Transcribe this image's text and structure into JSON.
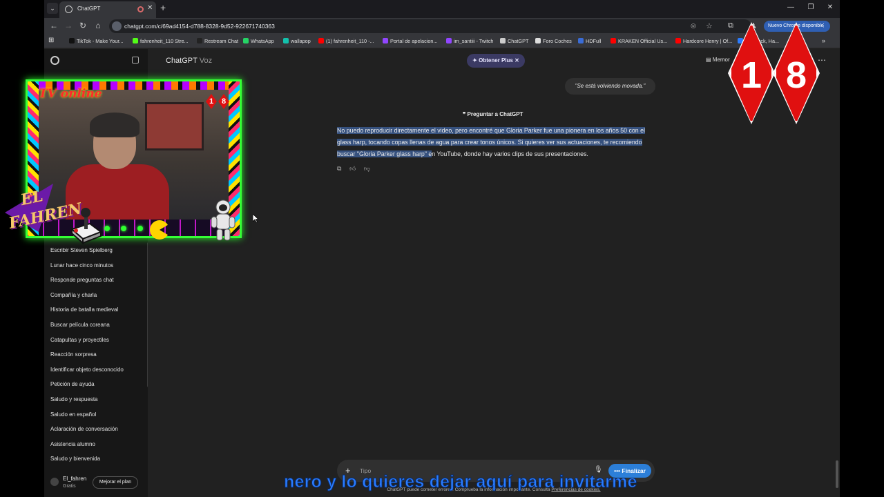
{
  "browser": {
    "tab_title": "ChatGPT",
    "url": "chatgpt.com/c/69ad4154-d788-8328-9d52-922671740363",
    "update_button": "Nuevo Chrome disponible",
    "bookmarks": [
      {
        "label": "TikTok - Make Your...",
        "color": "#111111"
      },
      {
        "label": "fahrenheit_110 Stre...",
        "color": "#53fc18"
      },
      {
        "label": "Restream Chat",
        "color": "#222222"
      },
      {
        "label": "WhatsApp",
        "color": "#25d366"
      },
      {
        "label": "wallapop",
        "color": "#13c1ac"
      },
      {
        "label": "(1) fahrenheit_110 -...",
        "color": "#ff0000"
      },
      {
        "label": "Portal de apelacion...",
        "color": "#9146ff"
      },
      {
        "label": "im_santiii - Twitch",
        "color": "#9146ff"
      },
      {
        "label": "ChatGPT",
        "color": "#cccccc"
      },
      {
        "label": "Foro Coches",
        "color": "#dddddd"
      },
      {
        "label": "HDFull",
        "color": "#3a6cd6"
      },
      {
        "label": "KRAKEN Official Us...",
        "color": "#ff0000"
      },
      {
        "label": "Hardcore Henry | Of...",
        "color": "#ff0000"
      },
      {
        "label": "ood Luck, Ha...",
        "color": "#2a7cff"
      }
    ]
  },
  "sidebar": {
    "items": [
      {
        "label": "Escribir Steven Spielberg"
      },
      {
        "label": "Lunar hace cinco minutos"
      },
      {
        "label": "Responde preguntas chat"
      },
      {
        "label": "Compañía y charla"
      },
      {
        "label": "Historia de batalla medieval"
      },
      {
        "label": "Buscar película coreana"
      },
      {
        "label": "Catapultas y proyectiles"
      },
      {
        "label": "Reacción sorpresa"
      },
      {
        "label": "Identificar objeto desconocido"
      },
      {
        "label": "Petición de ayuda"
      },
      {
        "label": "Saludo y respuesta"
      },
      {
        "label": "Saludo en español"
      },
      {
        "label": "Aclaración de conversación"
      },
      {
        "label": "Asistencia alumno"
      },
      {
        "label": "Saludo y bienvenida"
      }
    ],
    "user_name": "El_fahren",
    "user_plan": "Gratis",
    "upgrade_label": "Mejorar el plan"
  },
  "main": {
    "title": "ChatGPT",
    "title_sub": "Voz",
    "plus_label": "Obtener Plus",
    "memory_label": "Memor",
    "user_message": "\"Se está volviendo movada.\"",
    "ask_label": "Preguntar a ChatGPT",
    "answer_highlighted": "No puedo reproducir directamente el video, pero encontré que Gloria Parker fue una pionera en los años 50 con el glass harp, tocando copas llenas de agua para crear tonos únicos. Si quieres ver sus actuaciones, te recomiendo buscar \"Gloria Parker glass harp\" e",
    "answer_rest": "n YouTube, donde hay varios clips de sus presentaciones.",
    "composer_placeholder": "Tipo",
    "finish_label": "Finalizar",
    "disclaimer_main": "ChatGPT puede cometer errores. Comprueba la información importante. Consulta ",
    "disclaimer_link": "Preferencias de cookies."
  },
  "overlay": {
    "tv_online": "TV online",
    "logo_line1": "EL",
    "logo_line2": "FAHREN",
    "badge_small_1": "1",
    "badge_small_2": "8",
    "badge_big_1": "1",
    "badge_big_2": "8",
    "ticker_text": "nero y lo quieres dejar aquí para invitarme"
  }
}
